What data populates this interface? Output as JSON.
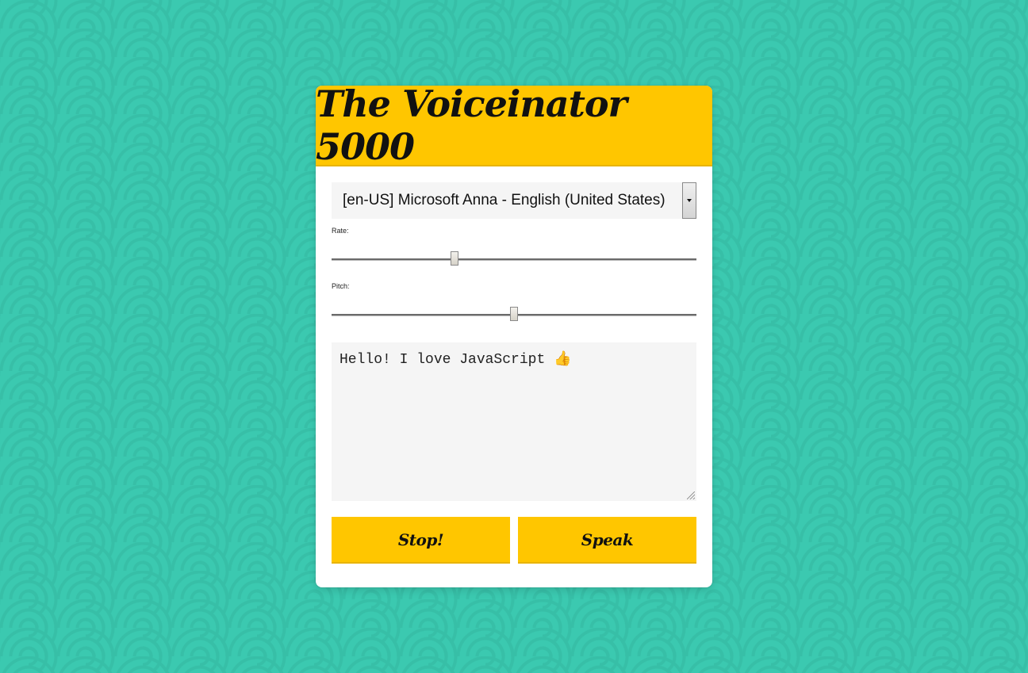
{
  "app": {
    "title": "The Voiceinator 5000"
  },
  "voice_select": {
    "selected": "[en-US] Microsoft Anna - English (United States)"
  },
  "rate": {
    "label": "Rate:",
    "value": 1,
    "min": 0,
    "max": 3
  },
  "pitch": {
    "label": "Pitch:",
    "value": 1,
    "min": 0,
    "max": 2
  },
  "message": {
    "text": "Hello! I love JavaScript 👍"
  },
  "buttons": {
    "stop_label": "Stop!",
    "speak_label": "Speak"
  },
  "colors": {
    "accent": "#ffc600",
    "background": "#3bc9b0",
    "panel": "#ffffff"
  }
}
